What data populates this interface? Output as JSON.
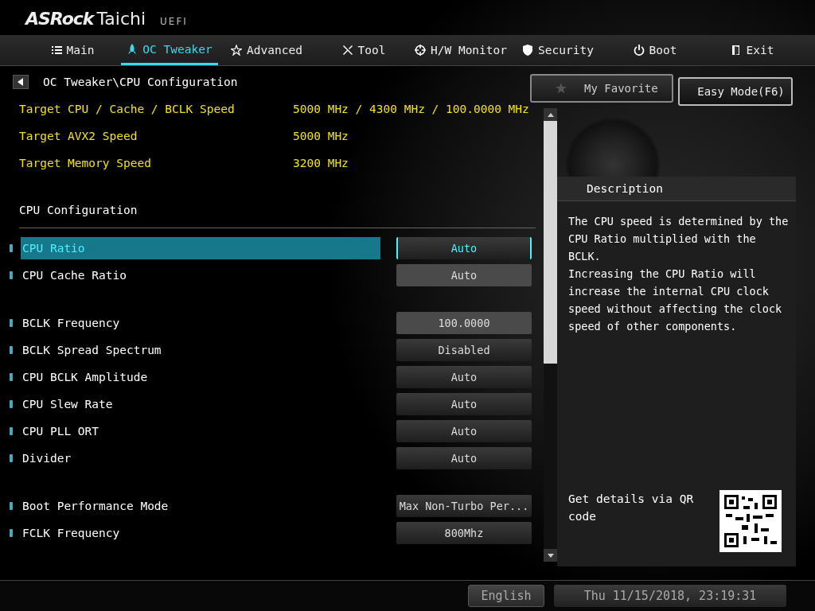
{
  "brand": {
    "name": "ASRock",
    "model": "Taichi",
    "suffix": "UEFI"
  },
  "tabs": [
    {
      "label": "Main",
      "selected": false
    },
    {
      "label": "OC Tweaker",
      "selected": true
    },
    {
      "label": "Advanced",
      "selected": false
    },
    {
      "label": "Tool",
      "selected": false
    },
    {
      "label": "H/W Monitor",
      "selected": false
    },
    {
      "label": "Security",
      "selected": false
    },
    {
      "label": "Boot",
      "selected": false
    },
    {
      "label": "Exit",
      "selected": false
    }
  ],
  "breadcrumb": "OC Tweaker\\CPU Configuration",
  "favorite_button": "My Favorite",
  "easy_mode_button": "Easy Mode(F6)",
  "targets": [
    {
      "label": "Target CPU / Cache / BCLK Speed",
      "value": "5000 MHz / 4300 MHz / 100.0000 MHz"
    },
    {
      "label": "Target AVX2 Speed",
      "value": "5000 MHz"
    },
    {
      "label": "Target Memory Speed",
      "value": "3200 MHz"
    }
  ],
  "section_title": "CPU Configuration",
  "setting_groups": [
    [
      {
        "label": "CPU Ratio",
        "value": "Auto",
        "kind": "option",
        "selected": true
      },
      {
        "label": "CPU Cache Ratio",
        "value": "Auto",
        "kind": "field",
        "selected": false
      }
    ],
    [
      {
        "label": "BCLK Frequency",
        "value": "100.0000",
        "kind": "field",
        "selected": false
      },
      {
        "label": "BCLK Spread Spectrum",
        "value": "Disabled",
        "kind": "option",
        "selected": false
      },
      {
        "label": "CPU BCLK Amplitude",
        "value": "Auto",
        "kind": "option",
        "selected": false
      },
      {
        "label": "CPU Slew Rate",
        "value": "Auto",
        "kind": "option",
        "selected": false
      },
      {
        "label": "CPU PLL ORT",
        "value": "Auto",
        "kind": "option",
        "selected": false
      },
      {
        "label": "Divider",
        "value": "Auto",
        "kind": "option",
        "selected": false
      }
    ],
    [
      {
        "label": "Boot Performance Mode",
        "value": "Max Non-Turbo Per...",
        "kind": "option",
        "selected": false
      },
      {
        "label": "FCLK Frequency",
        "value": "800Mhz",
        "kind": "option",
        "selected": false
      }
    ]
  ],
  "description": {
    "title": "Description",
    "paragraphs": [
      "The CPU speed is determined by the CPU Ratio multiplied with the BCLK.",
      "Increasing the CPU Ratio will increase the internal CPU clock speed without affecting the clock speed of other components."
    ],
    "qr_text": "Get details via QR code"
  },
  "status_bar": {
    "language": "English",
    "datetime": "Thu 11/15/2018, 23:19:31"
  }
}
